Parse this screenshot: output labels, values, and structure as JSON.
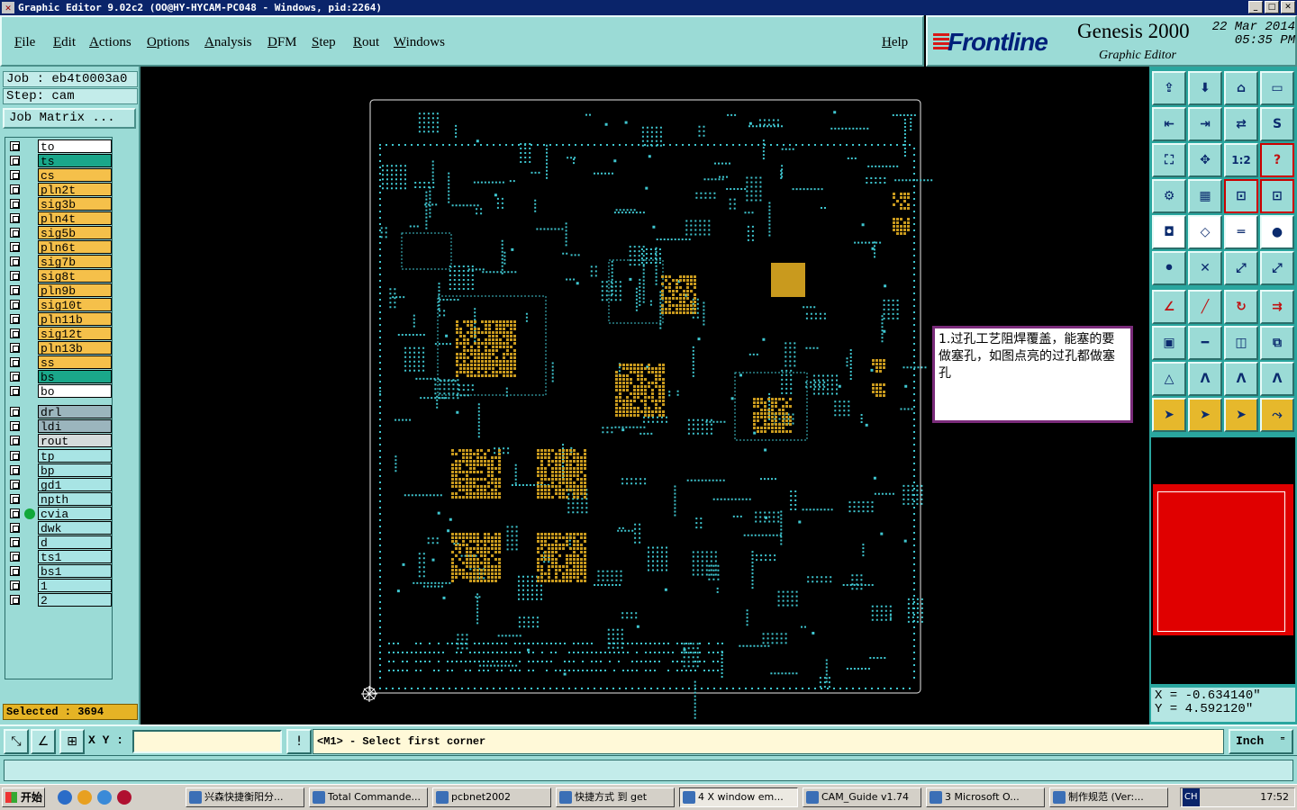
{
  "window": {
    "title": "Graphic Editor 9.02c2 (OO@HY-HYCAM-PC048 - Windows, pid:2264)",
    "icon": "x-icon"
  },
  "menu": [
    "File",
    "Edit",
    "Actions",
    "Options",
    "Analysis",
    "DFM",
    "Step",
    "Rout",
    "Windows"
  ],
  "help_label": "Help",
  "brand": {
    "logo": "Frontline",
    "product": "Genesis 2000",
    "subtitle": "Graphic Editor",
    "date": "22 Mar 2014",
    "time": "05:35 PM"
  },
  "job": {
    "job_line": "Job : eb4t0003a0",
    "step_line": "Step: cam",
    "matrix_button": "Job Matrix ..."
  },
  "layers": {
    "board": [
      {
        "name": "to",
        "color": "#ffffff"
      },
      {
        "name": "ts",
        "color": "#1aa78a"
      },
      {
        "name": "cs",
        "color": "#f5c04a"
      },
      {
        "name": "pln2t",
        "color": "#f5c04a"
      },
      {
        "name": "sig3b",
        "color": "#f5c04a"
      },
      {
        "name": "pln4t",
        "color": "#f5c04a"
      },
      {
        "name": "sig5b",
        "color": "#f5c04a"
      },
      {
        "name": "pln6t",
        "color": "#f5c04a"
      },
      {
        "name": "sig7b",
        "color": "#f5c04a"
      },
      {
        "name": "sig8t",
        "color": "#f5c04a"
      },
      {
        "name": "pln9b",
        "color": "#f5c04a"
      },
      {
        "name": "sig10t",
        "color": "#f5c04a"
      },
      {
        "name": "pln11b",
        "color": "#f5c04a"
      },
      {
        "name": "sig12t",
        "color": "#f5c04a"
      },
      {
        "name": "pln13b",
        "color": "#f5c04a"
      },
      {
        "name": "ss",
        "color": "#f5c04a"
      },
      {
        "name": "bs",
        "color": "#1aa78a"
      },
      {
        "name": "bo",
        "color": "#ffffff"
      }
    ],
    "drill": [
      {
        "name": "drl",
        "color": "#9bb5bd"
      },
      {
        "name": "ldi",
        "color": "#9bb5bd"
      },
      {
        "name": "rout",
        "color": "#d6dcdc"
      }
    ],
    "misc": [
      {
        "name": "tp",
        "color": "#a8e4e4"
      },
      {
        "name": "bp",
        "color": "#a8e4e4"
      },
      {
        "name": "gd1",
        "color": "#a8e4e4"
      },
      {
        "name": "npth",
        "color": "#a8e4e4"
      },
      {
        "name": "cvia",
        "color": "#a8e4e4",
        "work": true
      },
      {
        "name": "dwk",
        "color": "#a8e4e4"
      },
      {
        "name": "d",
        "color": "#a8e4e4"
      },
      {
        "name": "ts1",
        "color": "#a8e4e4"
      },
      {
        "name": "bs1",
        "color": "#a8e4e4"
      },
      {
        "name": "1",
        "color": "#a8e4e4"
      },
      {
        "name": "2",
        "color": "#a8e4e4"
      }
    ]
  },
  "selected": "Selected : 3694",
  "note": "1.过孔工艺阻焊覆盖，能塞的要做塞孔，如图点亮的过孔都做塞孔",
  "colors": {
    "via": "#3fc6d0",
    "pad": "#c99a1e",
    "outline": "#e8e8e8"
  },
  "toolbar_icons": [
    "home-top-icon",
    "zoom-home-icon",
    "house-icon",
    "split-window-icon",
    "pan-left-icon",
    "pan-right-icon",
    "flip-icon",
    "swap-icon",
    "fit-screen-icon",
    "zoom-fit-icon",
    "scale-1-2-icon",
    "help-icon",
    "measure-icon",
    "grid-icon",
    "snap-icon",
    "snap-alt-icon",
    "pad-icon",
    "edit-shape-icon",
    "ruler-icon",
    "circle-icon",
    "connect-icon",
    "cross-icon",
    "node-icon",
    "node-alt-icon",
    "angle-icon",
    "line-icon",
    "arc-icon",
    "ff-icon",
    "select-icon",
    "minus-icon",
    "frame-icon",
    "group-icon",
    "triangle-icon",
    "a-icon",
    "a-alt-icon",
    "a-red-icon",
    "pointer-icon",
    "pointer-alt-icon",
    "pointer-select-icon",
    "route-icon"
  ],
  "toolbar_text": {
    "scale": "1:2"
  },
  "coords": {
    "x": "X = -0.634140\"",
    "y": "Y = 4.592120\""
  },
  "cmd": {
    "xy_label": "X Y :",
    "xy_value": "",
    "prompt": "<M1> - Select first corner",
    "unit": "Inch"
  },
  "taskbar": {
    "start": "开始",
    "tasks": [
      "兴森快捷衡阳分...",
      "Total Commande...",
      "pcbnet2002",
      "快捷方式 到 get",
      "4 X window em...",
      "CAM_Guide v1.74",
      "3 Microsoft O...",
      "制作规范 (Ver:..."
    ],
    "clock": "17:52",
    "lang": "CH"
  }
}
